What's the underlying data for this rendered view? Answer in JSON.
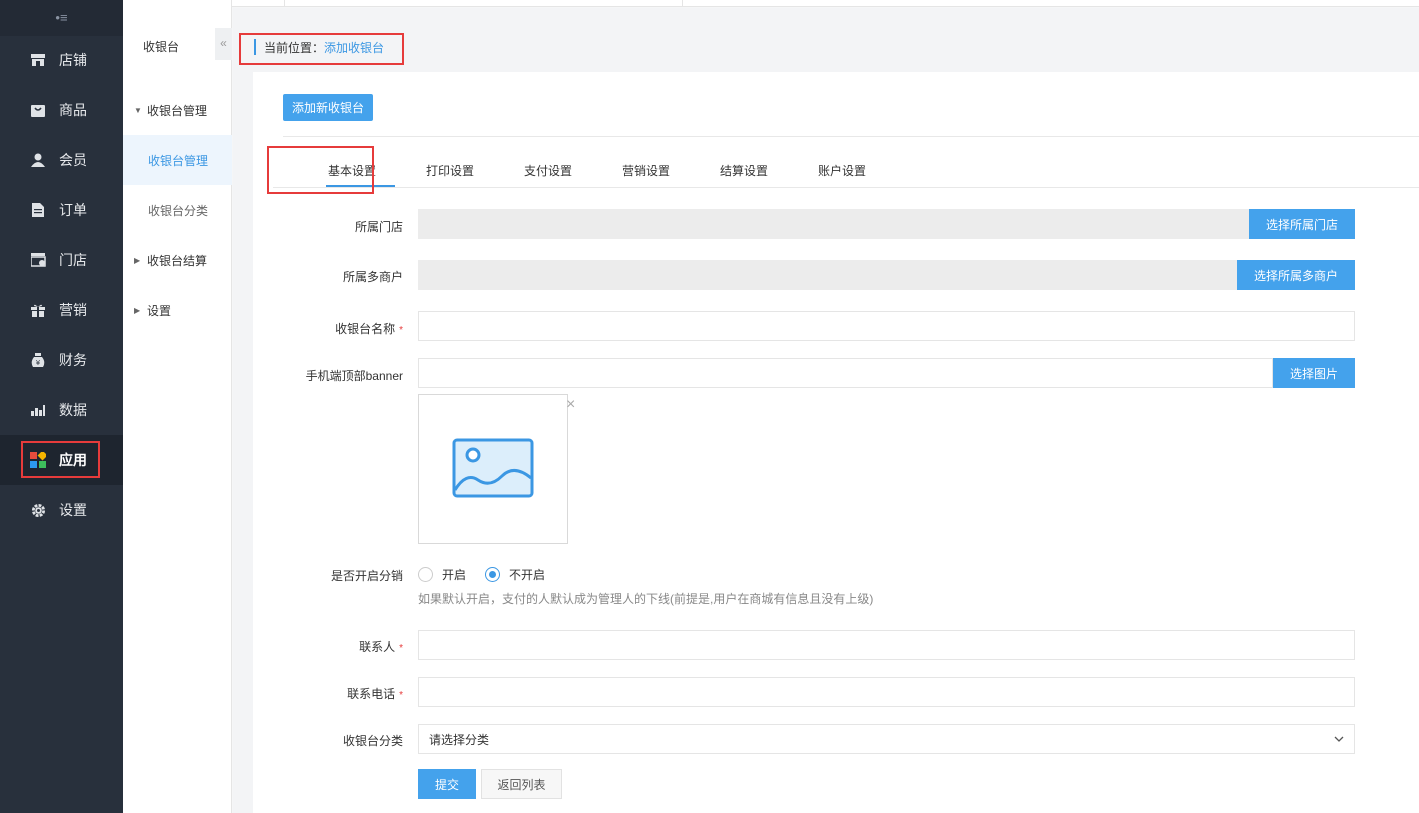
{
  "sidebar": {
    "collapse_glyph": "•≡",
    "items": [
      {
        "label": "店铺",
        "icon": "store-icon"
      },
      {
        "label": "商品",
        "icon": "bag-icon"
      },
      {
        "label": "会员",
        "icon": "user-icon"
      },
      {
        "label": "订单",
        "icon": "document-icon"
      },
      {
        "label": "门店",
        "icon": "shop-icon"
      },
      {
        "label": "营销",
        "icon": "gift-icon"
      },
      {
        "label": "财务",
        "icon": "money-bag-icon"
      },
      {
        "label": "数据",
        "icon": "chart-icon"
      },
      {
        "label": "应用",
        "icon": "apps-icon",
        "active": true
      },
      {
        "label": "设置",
        "icon": "gear-icon"
      }
    ]
  },
  "subpanel": {
    "title": "收银台",
    "collapse_glyph": "«",
    "groups": [
      {
        "label": "收银台管理",
        "expanded": true
      },
      {
        "label": "收银台管理",
        "child": true,
        "active": true
      },
      {
        "label": "收银台分类",
        "child": true
      },
      {
        "label": "收银台结算",
        "expanded": false
      },
      {
        "label": "设置",
        "expanded": false
      }
    ]
  },
  "breadcrumb": {
    "prefix": "当前位置：",
    "current": "添加收银台"
  },
  "toolbar": {
    "add_label": "添加新收银台"
  },
  "tabs": [
    "基本设置",
    "打印设置",
    "支付设置",
    "营销设置",
    "结算设置",
    "账户设置"
  ],
  "form": {
    "store": {
      "label": "所属门店",
      "button": "选择所属门店"
    },
    "merchant": {
      "label": "所属多商户",
      "button": "选择所属多商户"
    },
    "name": {
      "label": "收银台名称",
      "required": "*",
      "value": ""
    },
    "banner": {
      "label": "手机端顶部banner",
      "button": "选择图片",
      "close_glyph": "×"
    },
    "distribution": {
      "label": "是否开启分销",
      "options": [
        "开启",
        "不开启"
      ],
      "selected": "不开启",
      "hint": "如果默认开启，支付的人默认成为管理人的下线(前提是,用户在商城有信息且没有上级)"
    },
    "contact": {
      "label": "联系人",
      "required": "*",
      "value": ""
    },
    "phone": {
      "label": "联系电话",
      "required": "*",
      "value": ""
    },
    "category": {
      "label": "收银台分类",
      "selected": "请选择分类"
    },
    "submit_label": "提交",
    "back_label": "返回列表"
  },
  "colors": {
    "accent": "#44a2ec",
    "link": "#3b97e3",
    "sidebar_bg": "#28303c",
    "highlight": "#e63b3b"
  }
}
